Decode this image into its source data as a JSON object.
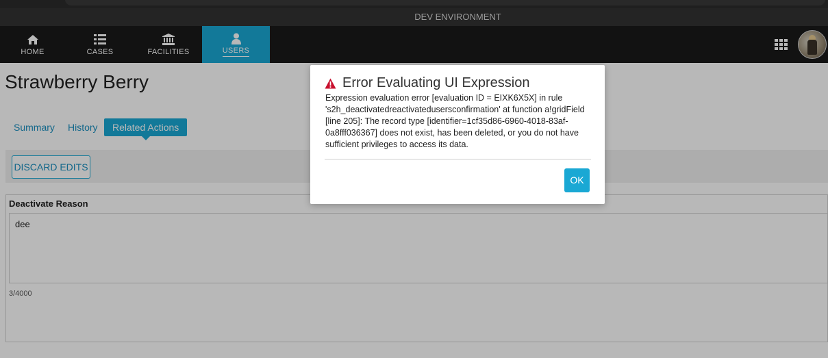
{
  "environment_banner": "DEV ENVIRONMENT",
  "nav": {
    "items": [
      {
        "label": "HOME",
        "icon": "home-icon"
      },
      {
        "label": "CASES",
        "icon": "list-icon"
      },
      {
        "label": "FACILITIES",
        "icon": "bank-icon"
      },
      {
        "label": "USERS",
        "icon": "user-icon",
        "active": true
      }
    ],
    "apps_icon": "grid-icon",
    "avatar": "user-avatar"
  },
  "page": {
    "title": "Strawberry Berry",
    "tabs": [
      {
        "label": "Summary"
      },
      {
        "label": "History"
      },
      {
        "label": "Related Actions",
        "active": true
      }
    ],
    "discard_label": "DISCARD EDITS",
    "field_label": "Deactivate Reason",
    "field_value": "dee",
    "char_counter": "3/4000"
  },
  "dialog": {
    "icon": "warning-icon",
    "title": "Error Evaluating UI Expression",
    "message": "Expression evaluation error [evaluation ID = EIXK6X5X] in rule 's2h_deactivatedreactivatedusersconfirmation' at function a!gridField [line 205]: The record type [identifier=1cf35d86-6960-4018-83af-0a8fff036367] does not exist, has been deleted, or you do not have sufficient privileges to access its data.",
    "ok_label": "OK"
  },
  "colors": {
    "accent": "#1aa8d4",
    "nav_background": "#1a1a1a",
    "warning": "#c8102e"
  }
}
